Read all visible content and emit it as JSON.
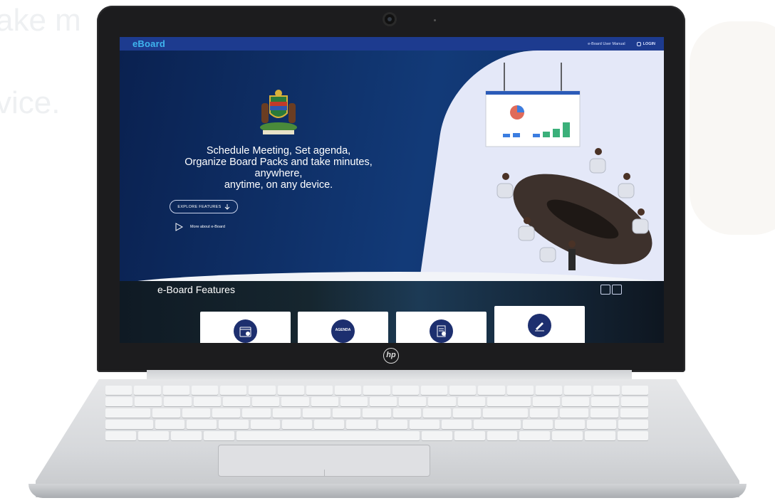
{
  "background": {
    "ghost_text_1": "ake m",
    "ghost_text_2": "vice."
  },
  "topbar": {
    "brand": "eBoard",
    "manual_link": "e-Board User Manual",
    "login_label": "LOGIN"
  },
  "hero": {
    "headline_lines": [
      "Schedule Meeting, Set agenda,",
      "Organize Board Packs and take minutes,",
      "anywhere,",
      "anytime, on any device."
    ],
    "explore_button": "EXPLORE FEATURES",
    "play_link": "More about e-Board"
  },
  "features": {
    "title": "e-Board Features",
    "cards": [
      {
        "icon": "calendar-icon"
      },
      {
        "icon": "agenda-icon",
        "label": "AGENDA"
      },
      {
        "icon": "checklist-icon"
      },
      {
        "icon": "pen-sign-icon"
      }
    ]
  },
  "colors": {
    "topbar": "#1d3b8f",
    "brand": "#3fb5ef",
    "hero": "#0f2a5a",
    "card_icon_bg": "#1d2f6f"
  },
  "device": {
    "logo": "hp"
  }
}
